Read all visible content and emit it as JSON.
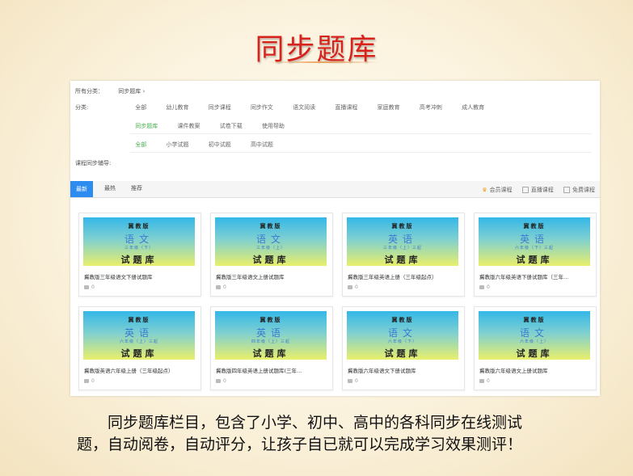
{
  "slide_title": "同步题库",
  "breadcrumb": {
    "all": "所有分类：",
    "current": "同步题库 ›"
  },
  "filters": {
    "category_label": "分类:",
    "categories": [
      "全部",
      "幼儿教育",
      "同步课程",
      "同步作文",
      "语文阅读",
      "直播课程",
      "家庭教育",
      "高考冲刺",
      "成人教育"
    ],
    "subcategories": [
      "同步题库",
      "课件教案",
      "试卷下载",
      "使用帮助"
    ],
    "levels": [
      "全部",
      "小学试题",
      "初中试题",
      "高中试题"
    ],
    "tutoring_label": "课程同步辅导:"
  },
  "tabs": [
    "最新",
    "最热",
    "推荐"
  ],
  "legend": [
    "会员课程",
    "直播课程",
    "免费课程"
  ],
  "cards": [
    {
      "edition": "冀教版",
      "subject": "语文",
      "grade": "三年级（下）",
      "library": "试题库",
      "name": "冀教版三年级语文下册试题库",
      "count": "0"
    },
    {
      "edition": "冀教版",
      "subject": "语文",
      "grade": "三年级（上）",
      "library": "试题库",
      "name": "冀教版三年级语文上册试题库",
      "count": "0"
    },
    {
      "edition": "冀教版",
      "subject": "英语",
      "grade": "三年级（上）三起",
      "library": "试题库",
      "name": "冀教版三年级英语上册（三年级起点）",
      "count": "0"
    },
    {
      "edition": "冀教版",
      "subject": "英语",
      "grade": "六年级（下）三起",
      "library": "试题库",
      "name": "冀教版六年级英语下册试题库（三年...",
      "count": "0"
    },
    {
      "edition": "冀教版",
      "subject": "英语",
      "grade": "六年级（上）三起",
      "library": "试题库",
      "name": "冀教版英语六年级上册（三年级起点）",
      "count": "0"
    },
    {
      "edition": "冀教版",
      "subject": "英语",
      "grade": "四年级（上）三起",
      "library": "试题库",
      "name": "冀教版四年级英语上册试题库(三年...",
      "count": "0"
    },
    {
      "edition": "冀教版",
      "subject": "语文",
      "grade": "六年级（下）",
      "library": "试题库",
      "name": "冀教版六年级语文下册试题库",
      "count": "0"
    },
    {
      "edition": "冀教版",
      "subject": "语文",
      "grade": "六年级（上）",
      "library": "试题库",
      "name": "冀教版六年级语文上册试题库",
      "count": "0"
    }
  ],
  "caption": {
    "line1": "同步题库栏目，包含了小学、初中、高中的各科同步在线测试",
    "line2": "题，自动阅卷，自动评分，让孩子自已就可以完成学习效果测评！"
  }
}
